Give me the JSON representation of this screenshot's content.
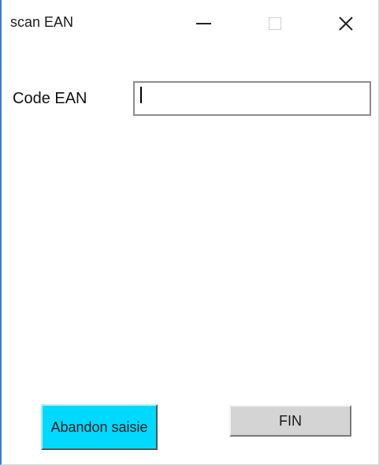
{
  "window": {
    "title": "scan EAN",
    "minimize_glyph": "",
    "maximize_glyph": "",
    "close_glyph": "✕"
  },
  "form": {
    "ean_label": "Code EAN",
    "ean_value": ""
  },
  "buttons": {
    "abandon_label": "Abandon saisie",
    "fin_label": "FIN"
  },
  "colors": {
    "abandon_bg": "#00d9ff",
    "fin_bg": "#d4d4d4",
    "window_accent": "#3b7bd6"
  }
}
